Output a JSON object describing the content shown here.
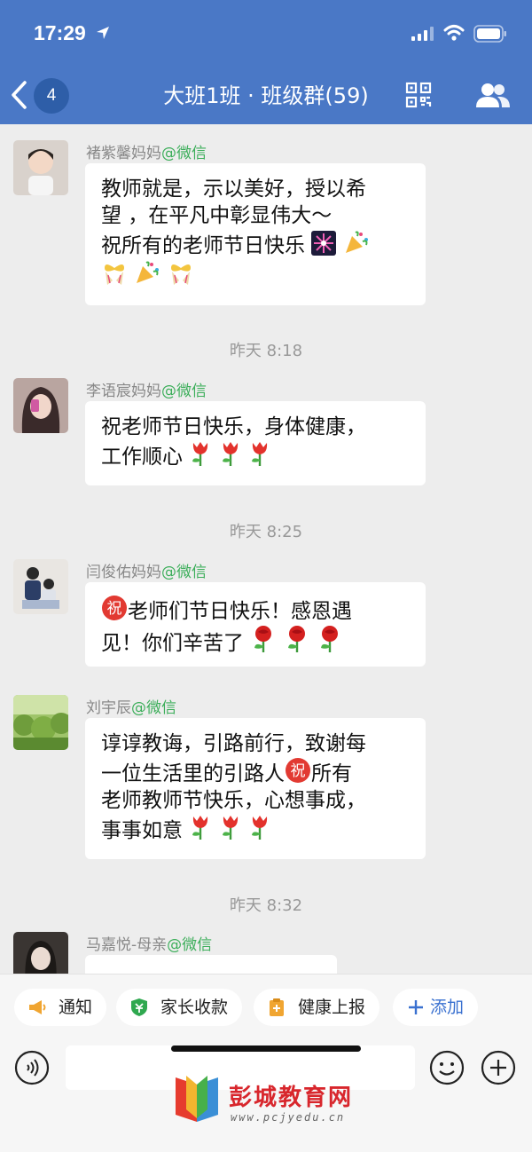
{
  "status_bar": {
    "time": "17:29"
  },
  "header": {
    "back_count": "4",
    "title": "大班1班 · 班级群(59)"
  },
  "messages": [
    {
      "sender": "褚紫馨妈妈",
      "suffix": "@微信",
      "lines": [
        "教师就是，示以美好，授以希",
        "望 ，在平凡中彰显伟大～",
        "祝所有的老师节日快乐"
      ]
    },
    {
      "time": "昨天 8:18"
    },
    {
      "sender": "李语宸妈妈",
      "suffix": "@微信",
      "lines": [
        "祝老师节日快乐，身体健康，",
        "工作顺心"
      ]
    },
    {
      "time": "昨天 8:25"
    },
    {
      "sender": "闫俊佑妈妈",
      "suffix": "@微信",
      "lines": [
        "老师们节日快乐！感恩遇",
        "见！你们辛苦了"
      ]
    },
    {
      "sender": "刘宇辰",
      "suffix": "@微信",
      "lines": [
        "谆谆教诲，引路前行，致谢每",
        "一位生活里的引路人",
        "所有",
        "老师教师节快乐，心想事成，",
        "事事如意"
      ]
    },
    {
      "time": "昨天 8:32"
    },
    {
      "sender": "马嘉悦-母亲",
      "suffix": "@微信"
    }
  ],
  "zhu_char": "祝",
  "toolbar": {
    "notice": "通知",
    "fees": "家长收款",
    "health": "健康上报",
    "add": "添加"
  },
  "watermark": {
    "title": "彭城教育网",
    "url": "www.pcjyedu.cn"
  },
  "icons": [
    "location-arrow-icon",
    "signal-icon",
    "wifi-icon",
    "battery-icon",
    "back-icon",
    "qr-code-icon",
    "group-members-icon",
    "firework-icon",
    "party-popper-icon",
    "gift-ribbon-icon",
    "tulip-icon",
    "rose-icon",
    "megaphone-icon",
    "payment-shield-icon",
    "clipboard-icon",
    "plus-icon",
    "voice-icon",
    "emoji-icon"
  ],
  "colors": {
    "header": "#4a78c6",
    "wechat_tag": "#3cae5a",
    "add_link": "#3a71d0",
    "watermark": "#d8262c"
  }
}
